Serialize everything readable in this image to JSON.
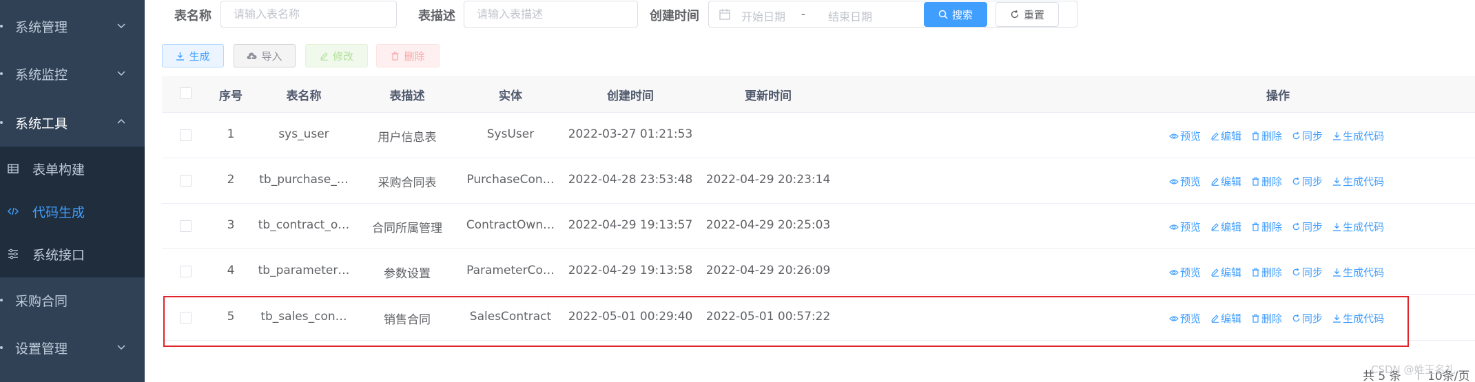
{
  "sidebar": {
    "items": [
      {
        "label": "系统管理",
        "chevron": "down"
      },
      {
        "label": "系统监控",
        "chevron": "down"
      },
      {
        "label": "系统工具",
        "chevron": "up"
      },
      {
        "label": "采购合同",
        "chevron": ""
      },
      {
        "label": "设置管理",
        "chevron": "down"
      }
    ],
    "sub_items": [
      {
        "label": "表单构建",
        "icon": "table-icon",
        "active": false
      },
      {
        "label": "代码生成",
        "icon": "code-icon",
        "active": true
      },
      {
        "label": "系统接口",
        "icon": "sliders-icon",
        "active": false
      }
    ]
  },
  "search": {
    "table_name_label": "表名称",
    "table_name_placeholder": "请输入表名称",
    "table_desc_label": "表描述",
    "table_desc_placeholder": "请输入表描述",
    "created_label": "创建时间",
    "start_placeholder": "开始日期",
    "range_separator": "-",
    "end_placeholder": "结束日期",
    "search_button": "搜索",
    "reset_button": "重置"
  },
  "toolbar": {
    "generate": "生成",
    "import": "导入",
    "modify": "修改",
    "delete": "删除"
  },
  "table": {
    "headers": {
      "index": "序号",
      "name": "表名称",
      "desc": "表描述",
      "entity": "实体",
      "created": "创建时间",
      "updated": "更新时间",
      "ops": "操作"
    },
    "rows": [
      {
        "index": "1",
        "name": "sys_user",
        "desc": "用户信息表",
        "entity": "SysUser",
        "created": "2022-03-27 01:21:53",
        "updated": ""
      },
      {
        "index": "2",
        "name": "tb_purchase_…",
        "desc": "采购合同表",
        "entity": "PurchaseCon…",
        "created": "2022-04-28 23:53:48",
        "updated": "2022-04-29 20:23:14"
      },
      {
        "index": "3",
        "name": "tb_contract_o…",
        "desc": "合同所属管理",
        "entity": "ContractOwn…",
        "created": "2022-04-29 19:13:57",
        "updated": "2022-04-29 20:25:03"
      },
      {
        "index": "4",
        "name": "tb_parameter…",
        "desc": "参数设置",
        "entity": "ParameterCo…",
        "created": "2022-04-29 19:13:58",
        "updated": "2022-04-29 20:26:09"
      },
      {
        "index": "5",
        "name": "tb_sales_con…",
        "desc": "销售合同",
        "entity": "SalesContract",
        "created": "2022-05-01 00:29:40",
        "updated": "2022-05-01 00:57:22"
      }
    ],
    "ops": {
      "preview": "预览",
      "edit": "编辑",
      "delete": "删除",
      "sync": "同步",
      "generate": "生成代码"
    }
  },
  "footer": {
    "total": "共 5 条",
    "page_size": "10条/页",
    "watermark": "CSDN @姓王名礼"
  },
  "colors": {
    "sidebar_bg": "#304156",
    "sidebar_sub_bg": "#1f2d3d",
    "primary": "#409eff",
    "highlight_border": "#e0222a"
  }
}
